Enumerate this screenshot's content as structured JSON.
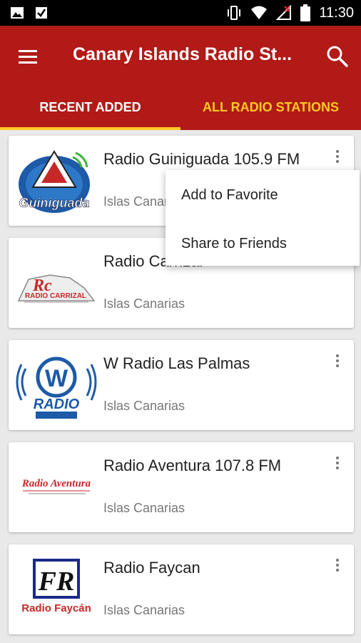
{
  "status_bar": {
    "time": "11:30",
    "icons": [
      "image-icon",
      "download-check-icon",
      "vibrate-icon",
      "wifi-icon",
      "no-signal-icon",
      "battery-icon"
    ]
  },
  "app_bar": {
    "title": "Canary Islands Radio St...",
    "menu_icon": "hamburger-menu-icon",
    "search_icon": "search-icon",
    "color": "#b11a16"
  },
  "tabs": [
    {
      "label": "RECENT ADDED",
      "active": true
    },
    {
      "label": "ALL RADIO STATIONS",
      "active": false
    }
  ],
  "accent_color": "#ffc928",
  "stations": [
    {
      "name": "Radio Guiniguada 105.9 FM",
      "subtitle": "Islas Canarias",
      "logo_text": "Guiniguada"
    },
    {
      "name": "Radio Carrizal",
      "subtitle": "Islas Canarias",
      "logo_text": "RADIO CARRIZAL"
    },
    {
      "name": "W Radio Las Palmas",
      "subtitle": "Islas Canarias",
      "logo_text": "RADIO"
    },
    {
      "name": "Radio Aventura 107.8 FM",
      "subtitle": "Islas Canarias",
      "logo_text": "Radio Aventura"
    },
    {
      "name": "Radio Faycan",
      "subtitle": "Islas Canarias",
      "logo_text": "Radio Faycán"
    }
  ],
  "popup_menu": {
    "items": [
      "Add to Favorite",
      "Share to Friends"
    ]
  }
}
